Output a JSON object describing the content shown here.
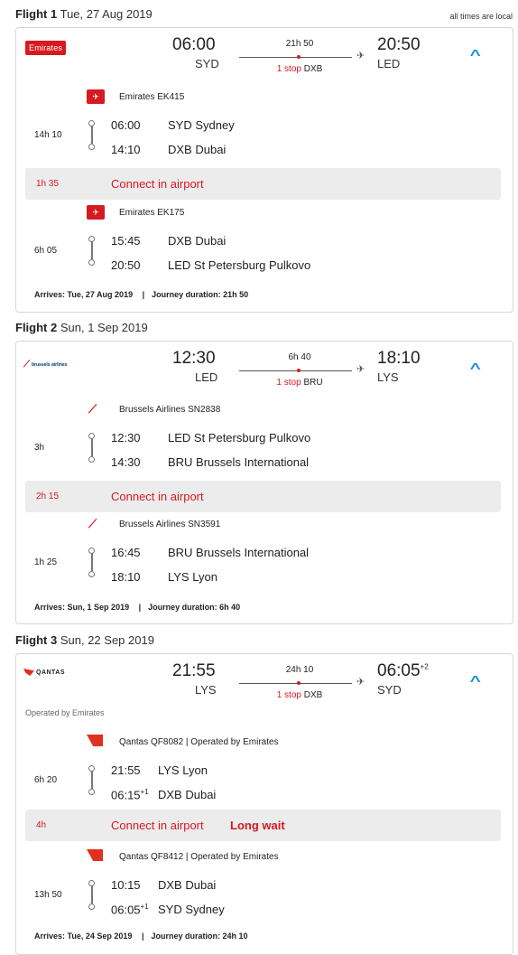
{
  "top_note": "all times are local",
  "flights": [
    {
      "header_label": "Flight 1",
      "header_date": "Tue, 27 Aug 2019",
      "airline_logo": "Emirates",
      "dep_time": "06:00",
      "dep_code": "SYD",
      "arr_time": "20:50",
      "arr_code": "LED",
      "arr_dayshift": "",
      "total_duration": "21h 50",
      "stops_label": "1 stop",
      "stop_code": "DXB",
      "operated_by": "",
      "legs": [
        {
          "carrier": "Emirates EK415",
          "duration": "14h 10",
          "dep_time": "06:00",
          "dep_shift": "",
          "dep_place": "SYD Sydney",
          "arr_time": "14:10",
          "arr_shift": "",
          "arr_place": "DXB Dubai"
        },
        {
          "carrier": "Emirates EK175",
          "duration": "6h 05",
          "dep_time": "15:45",
          "dep_shift": "",
          "dep_place": "DXB Dubai",
          "arr_time": "20:50",
          "arr_shift": "",
          "arr_place": "LED St Petersburg Pulkovo"
        }
      ],
      "connection": {
        "duration": "1h 35",
        "text": "Connect in airport",
        "wait": ""
      },
      "footer_arrives_label": "Arrives:",
      "footer_arrives": "Tue, 27 Aug 2019",
      "footer_sep": "|",
      "footer_duration_label": "Journey duration:",
      "footer_duration": "21h 50"
    },
    {
      "header_label": "Flight 2",
      "header_date": "Sun, 1 Sep 2019",
      "airline_logo": "brussels airlines",
      "dep_time": "12:30",
      "dep_code": "LED",
      "arr_time": "18:10",
      "arr_code": "LYS",
      "arr_dayshift": "",
      "total_duration": "6h 40",
      "stops_label": "1 stop",
      "stop_code": "BRU",
      "operated_by": "",
      "legs": [
        {
          "carrier": "Brussels Airlines SN2838",
          "duration": "3h",
          "dep_time": "12:30",
          "dep_shift": "",
          "dep_place": "LED St Petersburg Pulkovo",
          "arr_time": "14:30",
          "arr_shift": "",
          "arr_place": "BRU Brussels International"
        },
        {
          "carrier": "Brussels Airlines SN3591",
          "duration": "1h 25",
          "dep_time": "16:45",
          "dep_shift": "",
          "dep_place": "BRU Brussels International",
          "arr_time": "18:10",
          "arr_shift": "",
          "arr_place": "LYS Lyon"
        }
      ],
      "connection": {
        "duration": "2h 15",
        "text": "Connect in airport",
        "wait": ""
      },
      "footer_arrives_label": "Arrives:",
      "footer_arrives": "Sun, 1 Sep 2019",
      "footer_sep": "|",
      "footer_duration_label": "Journey duration:",
      "footer_duration": "6h 40"
    },
    {
      "header_label": "Flight 3",
      "header_date": "Sun, 22 Sep 2019",
      "airline_logo": "QANTAS",
      "dep_time": "21:55",
      "dep_code": "LYS",
      "arr_time": "06:05",
      "arr_code": "SYD",
      "arr_dayshift": "+2",
      "total_duration": "24h 10",
      "stops_label": "1 stop",
      "stop_code": "DXB",
      "operated_by": "Operated by Emirates",
      "legs": [
        {
          "carrier": "Qantas QF8082 | Operated by Emirates",
          "duration": "6h 20",
          "dep_time": "21:55",
          "dep_shift": "",
          "dep_place": "LYS Lyon",
          "arr_time": "06:15",
          "arr_shift": "+1",
          "arr_place": "DXB Dubai"
        },
        {
          "carrier": "Qantas QF8412 | Operated by Emirates",
          "duration": "13h 50",
          "dep_time": "10:15",
          "dep_shift": "",
          "dep_place": "DXB Dubai",
          "arr_time": "06:05",
          "arr_shift": "+1",
          "arr_place": "SYD Sydney"
        }
      ],
      "connection": {
        "duration": "4h",
        "text": "Connect in airport",
        "wait": "Long wait"
      },
      "footer_arrives_label": "Arrives:",
      "footer_arrives": "Tue, 24 Sep 2019",
      "footer_sep": "|",
      "footer_duration_label": "Journey duration:",
      "footer_duration": "24h 10"
    }
  ],
  "colors": {
    "accent_red": "#d71921",
    "chevron_blue": "#1a8fd6"
  }
}
